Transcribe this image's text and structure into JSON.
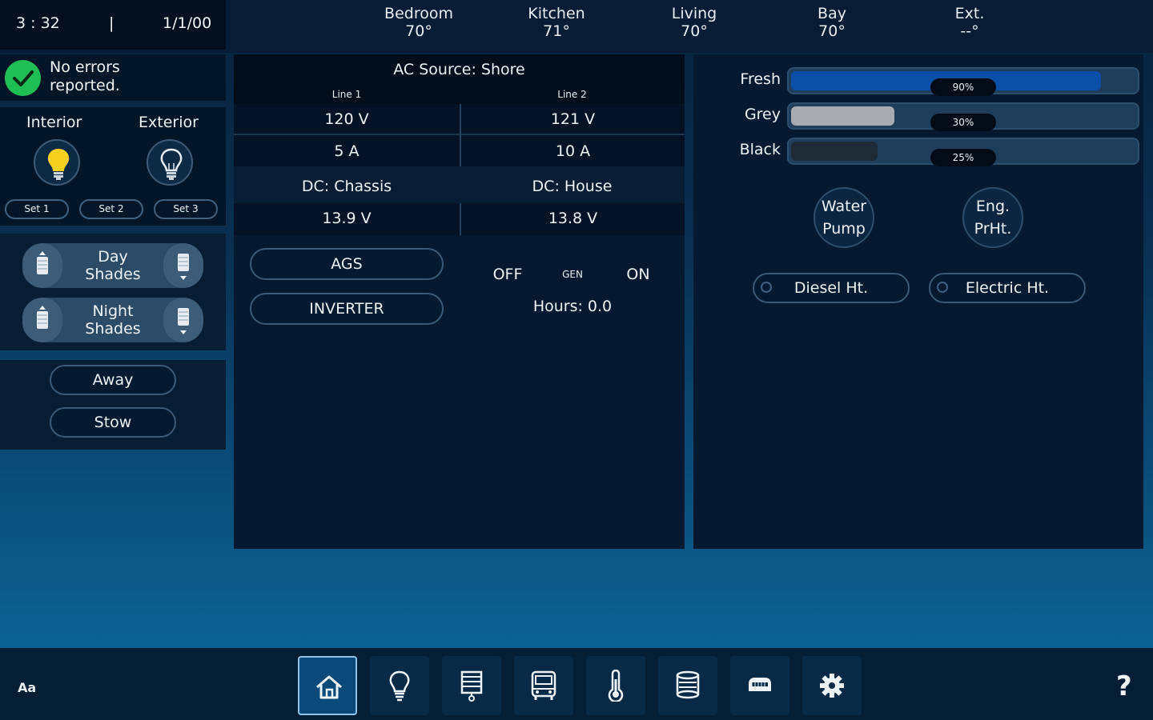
{
  "header": {
    "time": "3 : 32",
    "separator": "|",
    "date": "1/1/00",
    "zones": [
      {
        "name": "Bedroom",
        "temp": "70°"
      },
      {
        "name": "Kitchen",
        "temp": "71°"
      },
      {
        "name": "Living",
        "temp": "70°"
      },
      {
        "name": "Bay",
        "temp": "70°"
      },
      {
        "name": "Ext.",
        "temp": "--°"
      }
    ]
  },
  "status": {
    "message_line1": "No errors",
    "message_line2": "reported.",
    "color": "#1fbf55"
  },
  "lights": {
    "interior_label": "Interior",
    "exterior_label": "Exterior",
    "interior_bulb": "lightbulb-on-icon",
    "exterior_bulb": "lightbulb-off-icon",
    "sets": [
      "Set 1",
      "Set 2",
      "Set 3"
    ]
  },
  "shades": {
    "day": {
      "line1": "Day",
      "line2": "Shades"
    },
    "night": {
      "line1": "Night",
      "line2": "Shades"
    }
  },
  "modes": {
    "away": "Away",
    "stow": "Stow"
  },
  "power": {
    "ac_source": "AC Source: Shore",
    "line1_label": "Line 1",
    "line2_label": "Line 2",
    "line1_voltage": "120 V",
    "line2_voltage": "121 V",
    "line1_current": "5 A",
    "line2_current": "10 A",
    "dc_chassis_label": "DC: Chassis",
    "dc_house_label": "DC: House",
    "dc_chassis_value": "13.9 V",
    "dc_house_value": "13.8 V",
    "ags_label": "AGS",
    "inverter_label": "INVERTER",
    "gen_off": "OFF",
    "gen_label": "GEN",
    "gen_on": "ON",
    "hours": "Hours: 0.0"
  },
  "tanks": [
    {
      "name": "Fresh",
      "level": 0.9,
      "pct": "90%",
      "color": "#0b4fa8"
    },
    {
      "name": "Grey",
      "level": 0.3,
      "pct": "30%",
      "color": "#a8acb0"
    },
    {
      "name": "Black",
      "level": 0.25,
      "pct": "25%",
      "color": "#1e2a36"
    }
  ],
  "controls": {
    "water_pump": {
      "line1": "Water",
      "line2": "Pump"
    },
    "eng_preheat": {
      "line1": "Eng.",
      "line2": "PrHt."
    },
    "diesel_heat": "Diesel Ht.",
    "electric_heat": "Electric Ht."
  },
  "footer": {
    "font_toggle": "Aa",
    "help": "?",
    "nav": [
      "home-icon",
      "lightbulb-icon",
      "shades-icon",
      "vehicle-icon",
      "thermometer-icon",
      "tank-icon",
      "generator-icon",
      "gear-icon"
    ],
    "active_index": 0
  }
}
